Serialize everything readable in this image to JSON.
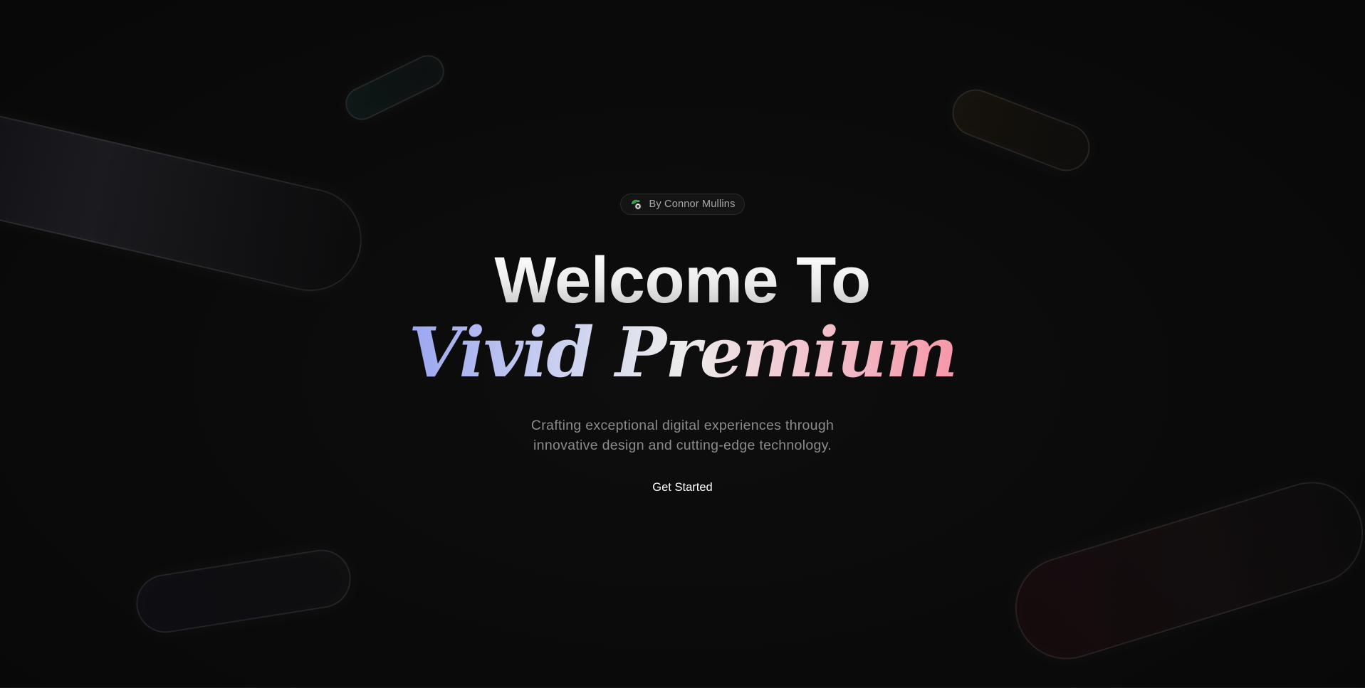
{
  "badge": {
    "icon": "leaf-avatar-icon",
    "label": "By Connor Mullins"
  },
  "hero": {
    "title_line_1": "Welcome To",
    "title_line_2": "Vivid Premium",
    "subtitle_line_1": "Crafting exceptional digital experiences through",
    "subtitle_line_2": "innovative design and cutting-edge technology."
  },
  "cta": {
    "label": "Get Started"
  },
  "colors": {
    "background": "#0a0a0a",
    "gradient_start": "#9aa6f0",
    "gradient_mid": "#ececec",
    "gradient_end": "#f697a8",
    "subtitle": "#8c8c8c"
  }
}
